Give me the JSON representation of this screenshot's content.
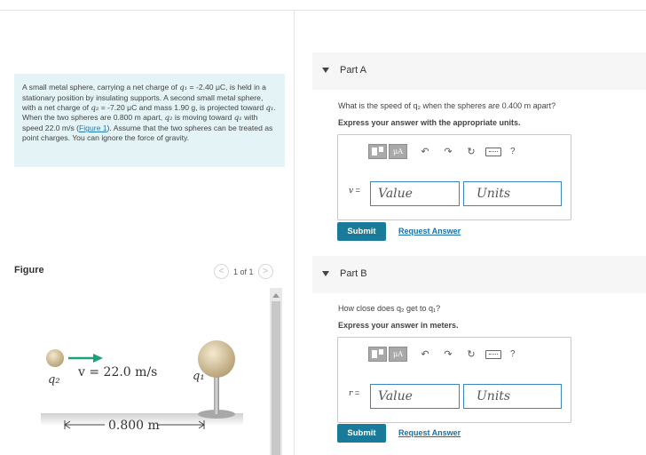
{
  "problem": {
    "t1": "A small metal sphere, carrying a net charge of ",
    "q1": "q₁",
    "t2": " = -2.40 μC, is held in a stationary position by insulating supports. A second small metal sphere, with a net charge of ",
    "q2": "q₂",
    "t3": " = -7.20 μC and mass 1.90 g, is projected toward ",
    "q1b": "q₁",
    "t4": ". When the two spheres are 0.800 m apart, ",
    "q2b": "q₂",
    "t5": " is moving toward ",
    "q1c": "q₁",
    "t6": " with speed 22.0 m/s (",
    "link": "Figure 1",
    "t7": "). Assume that the two spheres can be treated as point charges. You can ignore the force of gravity."
  },
  "figure": {
    "title": "Figure",
    "page_indicator": "1 of 1",
    "prev_symbol": "<",
    "next_symbol": ">",
    "q2_label": "q₂",
    "q1_label": "q₁",
    "velocity_label": "v = 22.0 m/s",
    "distance_label": "0.800 m"
  },
  "part_a": {
    "title": "Part A",
    "question": "What is the speed of q₂ when the spheres are 0.400 m apart?",
    "instruction": "Express your answer with the appropriate units.",
    "var": "v",
    "eq": " =",
    "value_placeholder": "Value",
    "units_placeholder": "Units",
    "tb_mu": "μA",
    "submit": "Submit",
    "request": "Request Answer"
  },
  "part_b": {
    "title": "Part B",
    "question": "How close does q₂ get to q₁?",
    "instruction": "Express your answer in meters.",
    "var": "r",
    "eq": " =",
    "value_placeholder": "Value",
    "units_placeholder": "Units",
    "tb_mu": "μA",
    "submit": "Submit",
    "request": "Request Answer"
  },
  "toolbar_icons": [
    "templates-icon",
    "mu-units-icon",
    "undo-icon",
    "redo-icon",
    "reset-icon",
    "keyboard-icon",
    "help-icon"
  ]
}
